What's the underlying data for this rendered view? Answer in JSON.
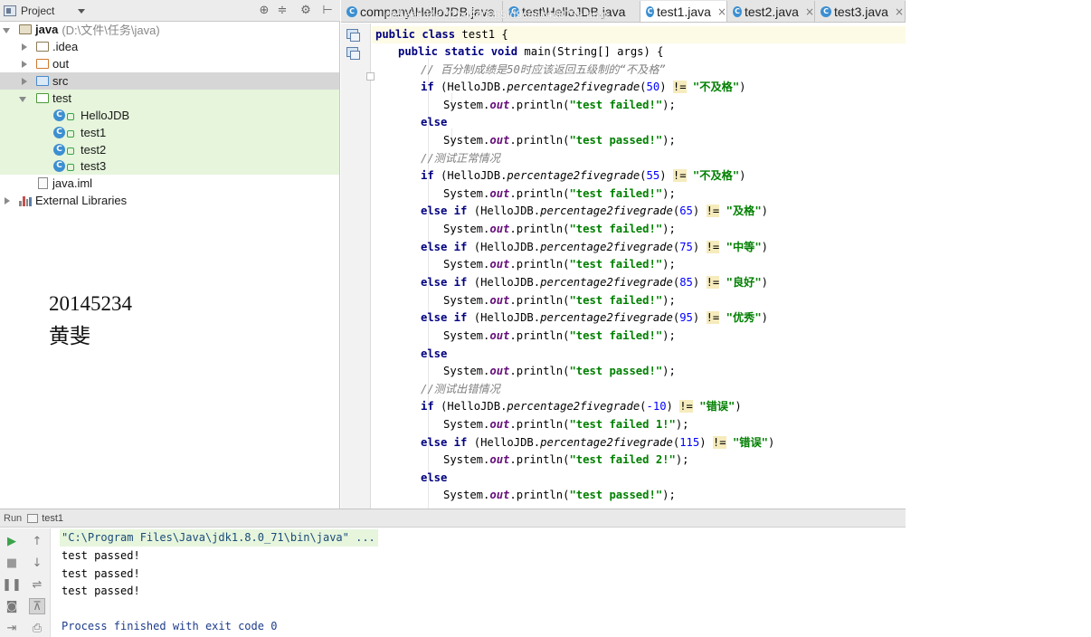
{
  "project_panel": {
    "selector_label": "Project",
    "toolbar_icons": [
      "target-icon",
      "collapse-icon",
      "gear-icon",
      "hide-panel-icon"
    ],
    "tree": [
      {
        "label": "java",
        "path": "(D:\\文件\\任务\\java)",
        "icon": "module-folder-icon",
        "expanded": true
      },
      {
        "label": ".idea",
        "icon": "folder-icon"
      },
      {
        "label": "out",
        "icon": "excluded-folder-icon"
      },
      {
        "label": "src",
        "icon": "source-folder-icon",
        "selected": true
      },
      {
        "label": "test",
        "icon": "test-folder-icon",
        "expanded": true
      },
      {
        "label": "HelloJDB",
        "icon": "class-icon"
      },
      {
        "label": "test1",
        "icon": "class-icon"
      },
      {
        "label": "test2",
        "icon": "class-icon"
      },
      {
        "label": "test3",
        "icon": "class-icon"
      },
      {
        "label": "java.iml",
        "icon": "file-icon"
      },
      {
        "label": "External Libraries",
        "icon": "library-icon"
      }
    ]
  },
  "annotation": {
    "student_id": "20145234",
    "student_name": "黄斐"
  },
  "editor": {
    "tabs": [
      {
        "label": "company\\HelloJDB.java",
        "active": false
      },
      {
        "label": "test\\HelloJDB.java",
        "active": false
      },
      {
        "label": "test1.java",
        "active": true
      },
      {
        "label": "test2.java",
        "active": false
      },
      {
        "label": "test3.java",
        "active": false
      }
    ],
    "tab_overlay_text": "de5ee037e7f2b44400b5fd9c8ec4d873e.bmp",
    "tab_close_glyph": "×"
  },
  "code": {
    "l1": {
      "kw": "public class",
      "rest": " test1 {"
    },
    "l2": {
      "kw": "public static void",
      "rest": " main(String[] args) {"
    },
    "l3": {
      "comment": "// 百分制成绩是50时应该返回五级制的“不及格”"
    },
    "l4": {
      "arg": "50",
      "str": "\"不及格\""
    },
    "l5": {
      "str": "\"test failed!\""
    },
    "l7": {
      "str": "\"test passed!\""
    },
    "l8": {
      "comment": "//测试正常情况"
    },
    "l9": {
      "arg": "55",
      "str": "\"不及格\""
    },
    "l10": {
      "str": "\"test failed!\""
    },
    "l11": {
      "arg": "65",
      "str": "\"及格\""
    },
    "l12": {
      "str": "\"test failed!\""
    },
    "l13": {
      "arg": "75",
      "str": "\"中等\""
    },
    "l14": {
      "str": "\"test failed!\""
    },
    "l15": {
      "arg": "85",
      "str": "\"良好\""
    },
    "l16": {
      "str": "\"test failed!\""
    },
    "l17": {
      "arg": "95",
      "str": "\"优秀\""
    },
    "l18": {
      "str": "\"test failed!\""
    },
    "l20": {
      "str": "\"test passed!\""
    },
    "l21": {
      "comment": "//测试出错情况"
    },
    "l22": {
      "arg": "-10",
      "str": "\"错误\""
    },
    "l23": {
      "str": "\"test failed 1!\""
    },
    "l24": {
      "arg": "115",
      "str": "\"错误\""
    },
    "l25": {
      "str": "\"test failed 2!\""
    },
    "l27": {
      "str": "\"test passed!\""
    },
    "tokens": {
      "if": "if",
      "else": "else",
      "else_if": "else if",
      "class_ref": "HelloJDB.",
      "method": "percentage2fivegrade",
      "neq": "!=",
      "system": "System.",
      "out": "out",
      "println": ".println(",
      "stmt_end": ");"
    }
  },
  "run_panel": {
    "label": "Run",
    "tab": "test1",
    "output": [
      "\"C:\\Program Files\\Java\\jdk1.8.0_71\\bin\\java\" ...",
      "test passed!",
      "test passed!",
      "test passed!",
      "",
      "Process finished with exit code 0"
    ],
    "buttons": [
      "run-icon",
      "stop-icon",
      "pause-icon",
      "dump-icon",
      "exit-icon",
      "up-icon",
      "down-icon",
      "soft-wrap-icon",
      "pin-icon",
      "print-icon"
    ]
  },
  "colors": {
    "keyword": "#000080",
    "string": "#008000",
    "number": "#0000ff",
    "comment": "#808080",
    "field": "#660e7a",
    "selection_bg": "#d6d6d6",
    "test_folder_bg": "#e6f5dc"
  }
}
